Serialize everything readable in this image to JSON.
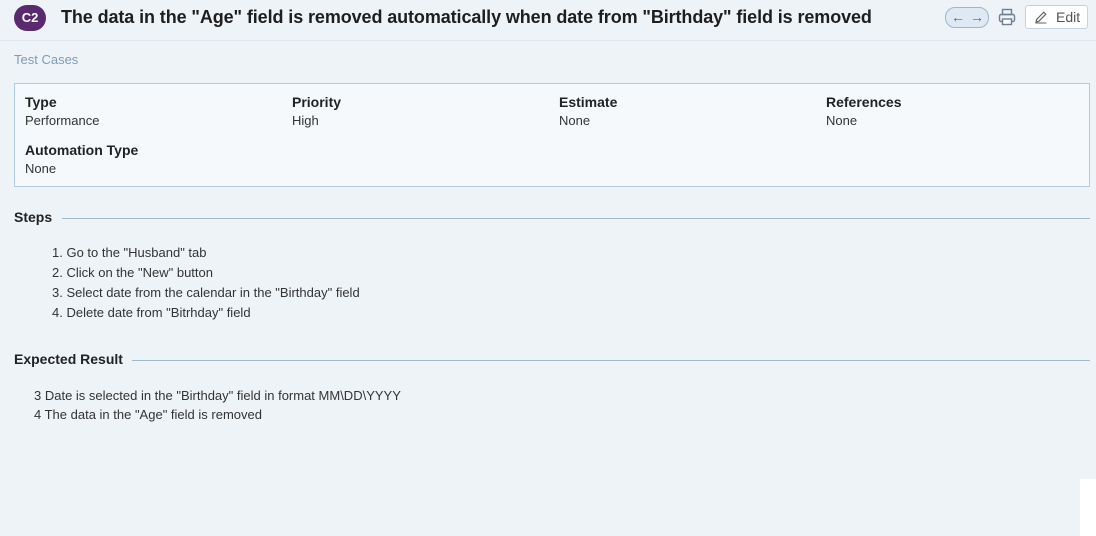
{
  "header": {
    "case_id": "C2",
    "title": "The data in the \"Age\" field is removed automatically when date from \"Birthday\" field is removed",
    "edit_label": "Edit",
    "nav_prev_icon": "arrow-left-icon",
    "nav_next_icon": "arrow-right-icon",
    "print_icon": "print-icon",
    "edit_icon": "pencil-icon"
  },
  "breadcrumb": {
    "link": "Test Cases"
  },
  "fields": {
    "type": {
      "label": "Type",
      "value": "Performance"
    },
    "priority": {
      "label": "Priority",
      "value": "High"
    },
    "estimate": {
      "label": "Estimate",
      "value": "None"
    },
    "references": {
      "label": "References",
      "value": "None"
    },
    "automation_type": {
      "label": "Automation Type",
      "value": "None"
    }
  },
  "steps": {
    "title": "Steps",
    "items": [
      "1. Go to the \"Husband\" tab",
      "2. Click on the \"New\" button",
      "3. Select date from the calendar in the \"Birthday\" field",
      "4. Delete date from \"Bitrhday\" field"
    ]
  },
  "expected_result": {
    "title": "Expected Result",
    "items": [
      "3 Date is selected in the \"Birthday\" field in format MM\\DD\\YYYY",
      "4 The data in the \"Age\" field is removed"
    ]
  },
  "colors": {
    "badge": "#5a2a6f",
    "background": "#eef3f8",
    "info_border": "#b3cbe0",
    "link": "#7f9cb4"
  }
}
